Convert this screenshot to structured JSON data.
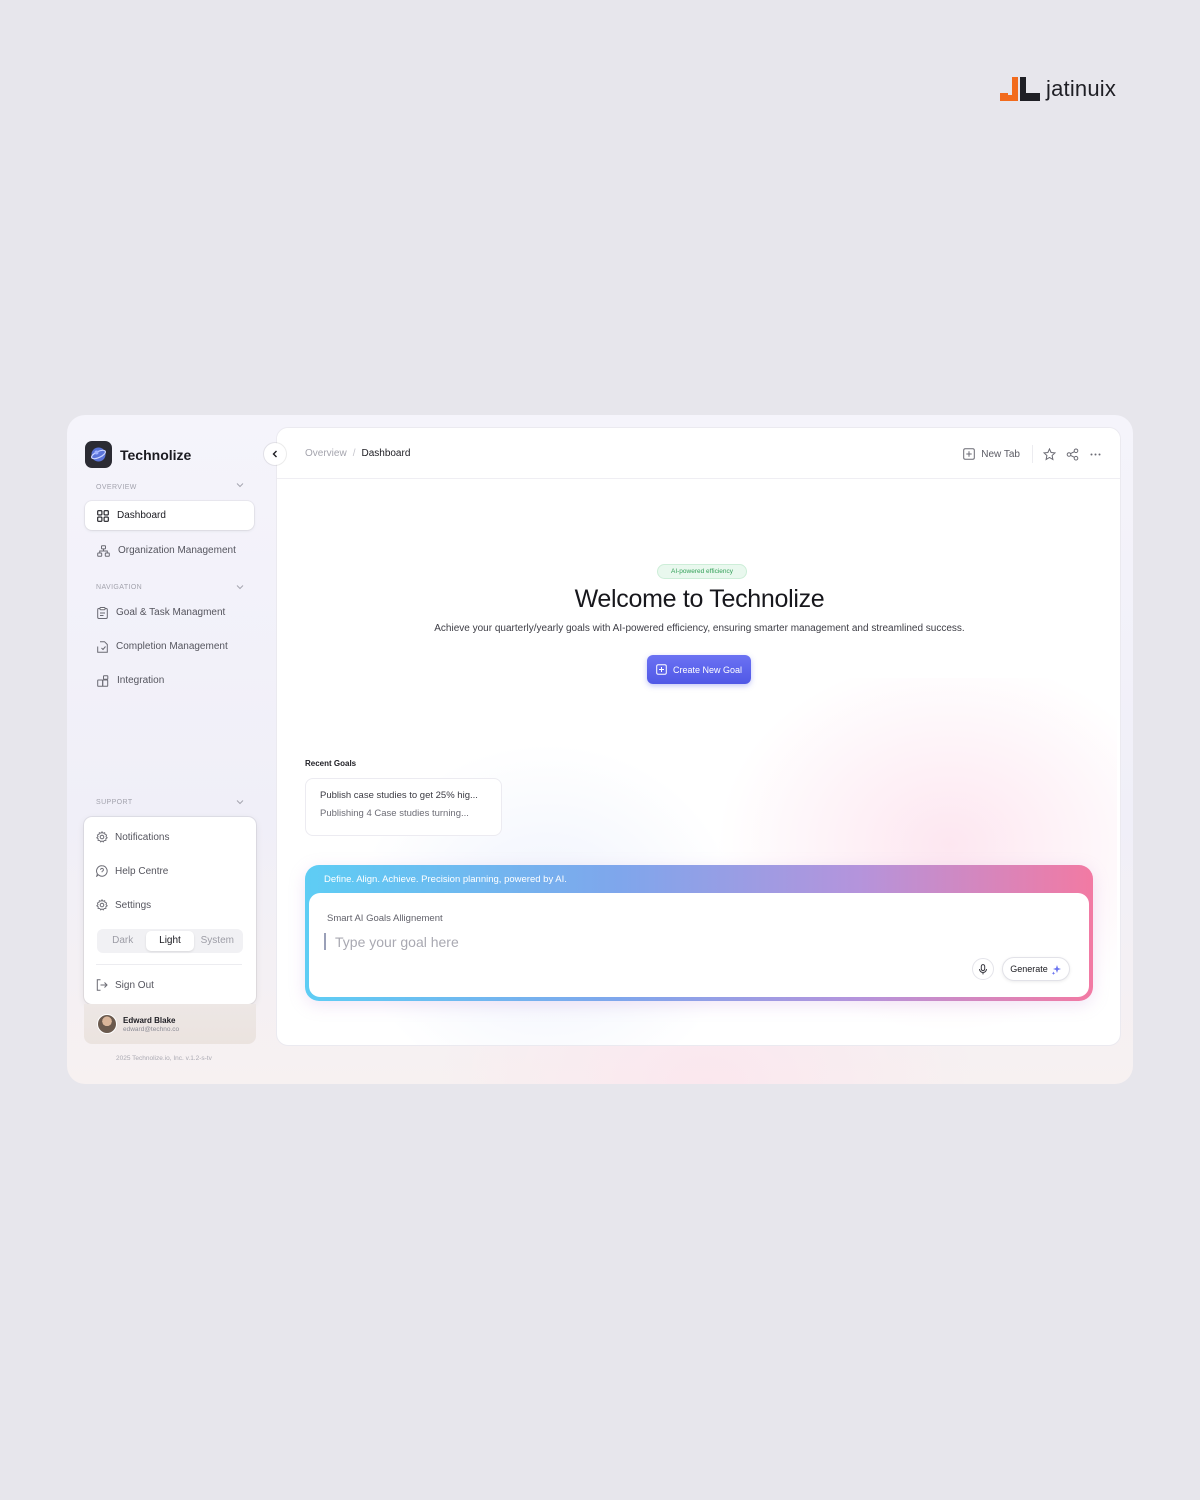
{
  "brand": {
    "name": "jatinuix",
    "colors": {
      "orange": "#f26b1d",
      "dark": "#1f1f25"
    }
  },
  "app": {
    "name": "Technolize",
    "accent": "#5a61ee"
  },
  "sidebar": {
    "overview_label": "OVERVIEW",
    "overview_items": [
      {
        "label": "Dashboard",
        "icon": "grid-icon",
        "active": true
      },
      {
        "label": "Organization Management",
        "icon": "org-chart-icon"
      }
    ],
    "navigation_label": "NAVIGATION",
    "navigation_items": [
      {
        "label": "Goal & Task Managment",
        "icon": "clipboard-icon"
      },
      {
        "label": "Completion Management",
        "icon": "file-check-icon"
      },
      {
        "label": "Integration",
        "icon": "blocks-icon"
      }
    ],
    "support_label": "SUPPORT",
    "support_items": [
      {
        "label": "Notifications",
        "icon": "gear-icon"
      },
      {
        "label": "Help Centre",
        "icon": "help-chat-icon"
      },
      {
        "label": "Settings",
        "icon": "gear-icon"
      }
    ],
    "theme": {
      "options": [
        "Dark",
        "Light",
        "System"
      ],
      "selected": "Light"
    },
    "signout_label": "Sign Out",
    "user": {
      "name": "Edward Blake",
      "email": "edward@techno.co"
    },
    "footer": "2025 Technolize.io, Inc. v.1.2-s-tv"
  },
  "topbar": {
    "breadcrumb": [
      "Overview",
      "Dashboard"
    ],
    "breadcrumb_sep": "/",
    "new_tab_label": "New Tab"
  },
  "hero": {
    "pill": "AI-powered efficiency",
    "title": "Welcome to Technolize",
    "subtitle": "Achieve your quarterly/yearly goals with AI-powered efficiency, ensuring smarter management and streamlined success.",
    "cta_label": "Create New Goal"
  },
  "recent": {
    "title": "Recent Goals",
    "items": [
      "Publish case studies to get 25% hig...",
      "Publishing 4 Case studies turning..."
    ]
  },
  "ai": {
    "tagline": "Define. Align. Achieve. Precision planning, powered by AI.",
    "label": "Smart AI Goals Allignement",
    "placeholder": "Type your goal here",
    "generate_label": "Generate"
  }
}
